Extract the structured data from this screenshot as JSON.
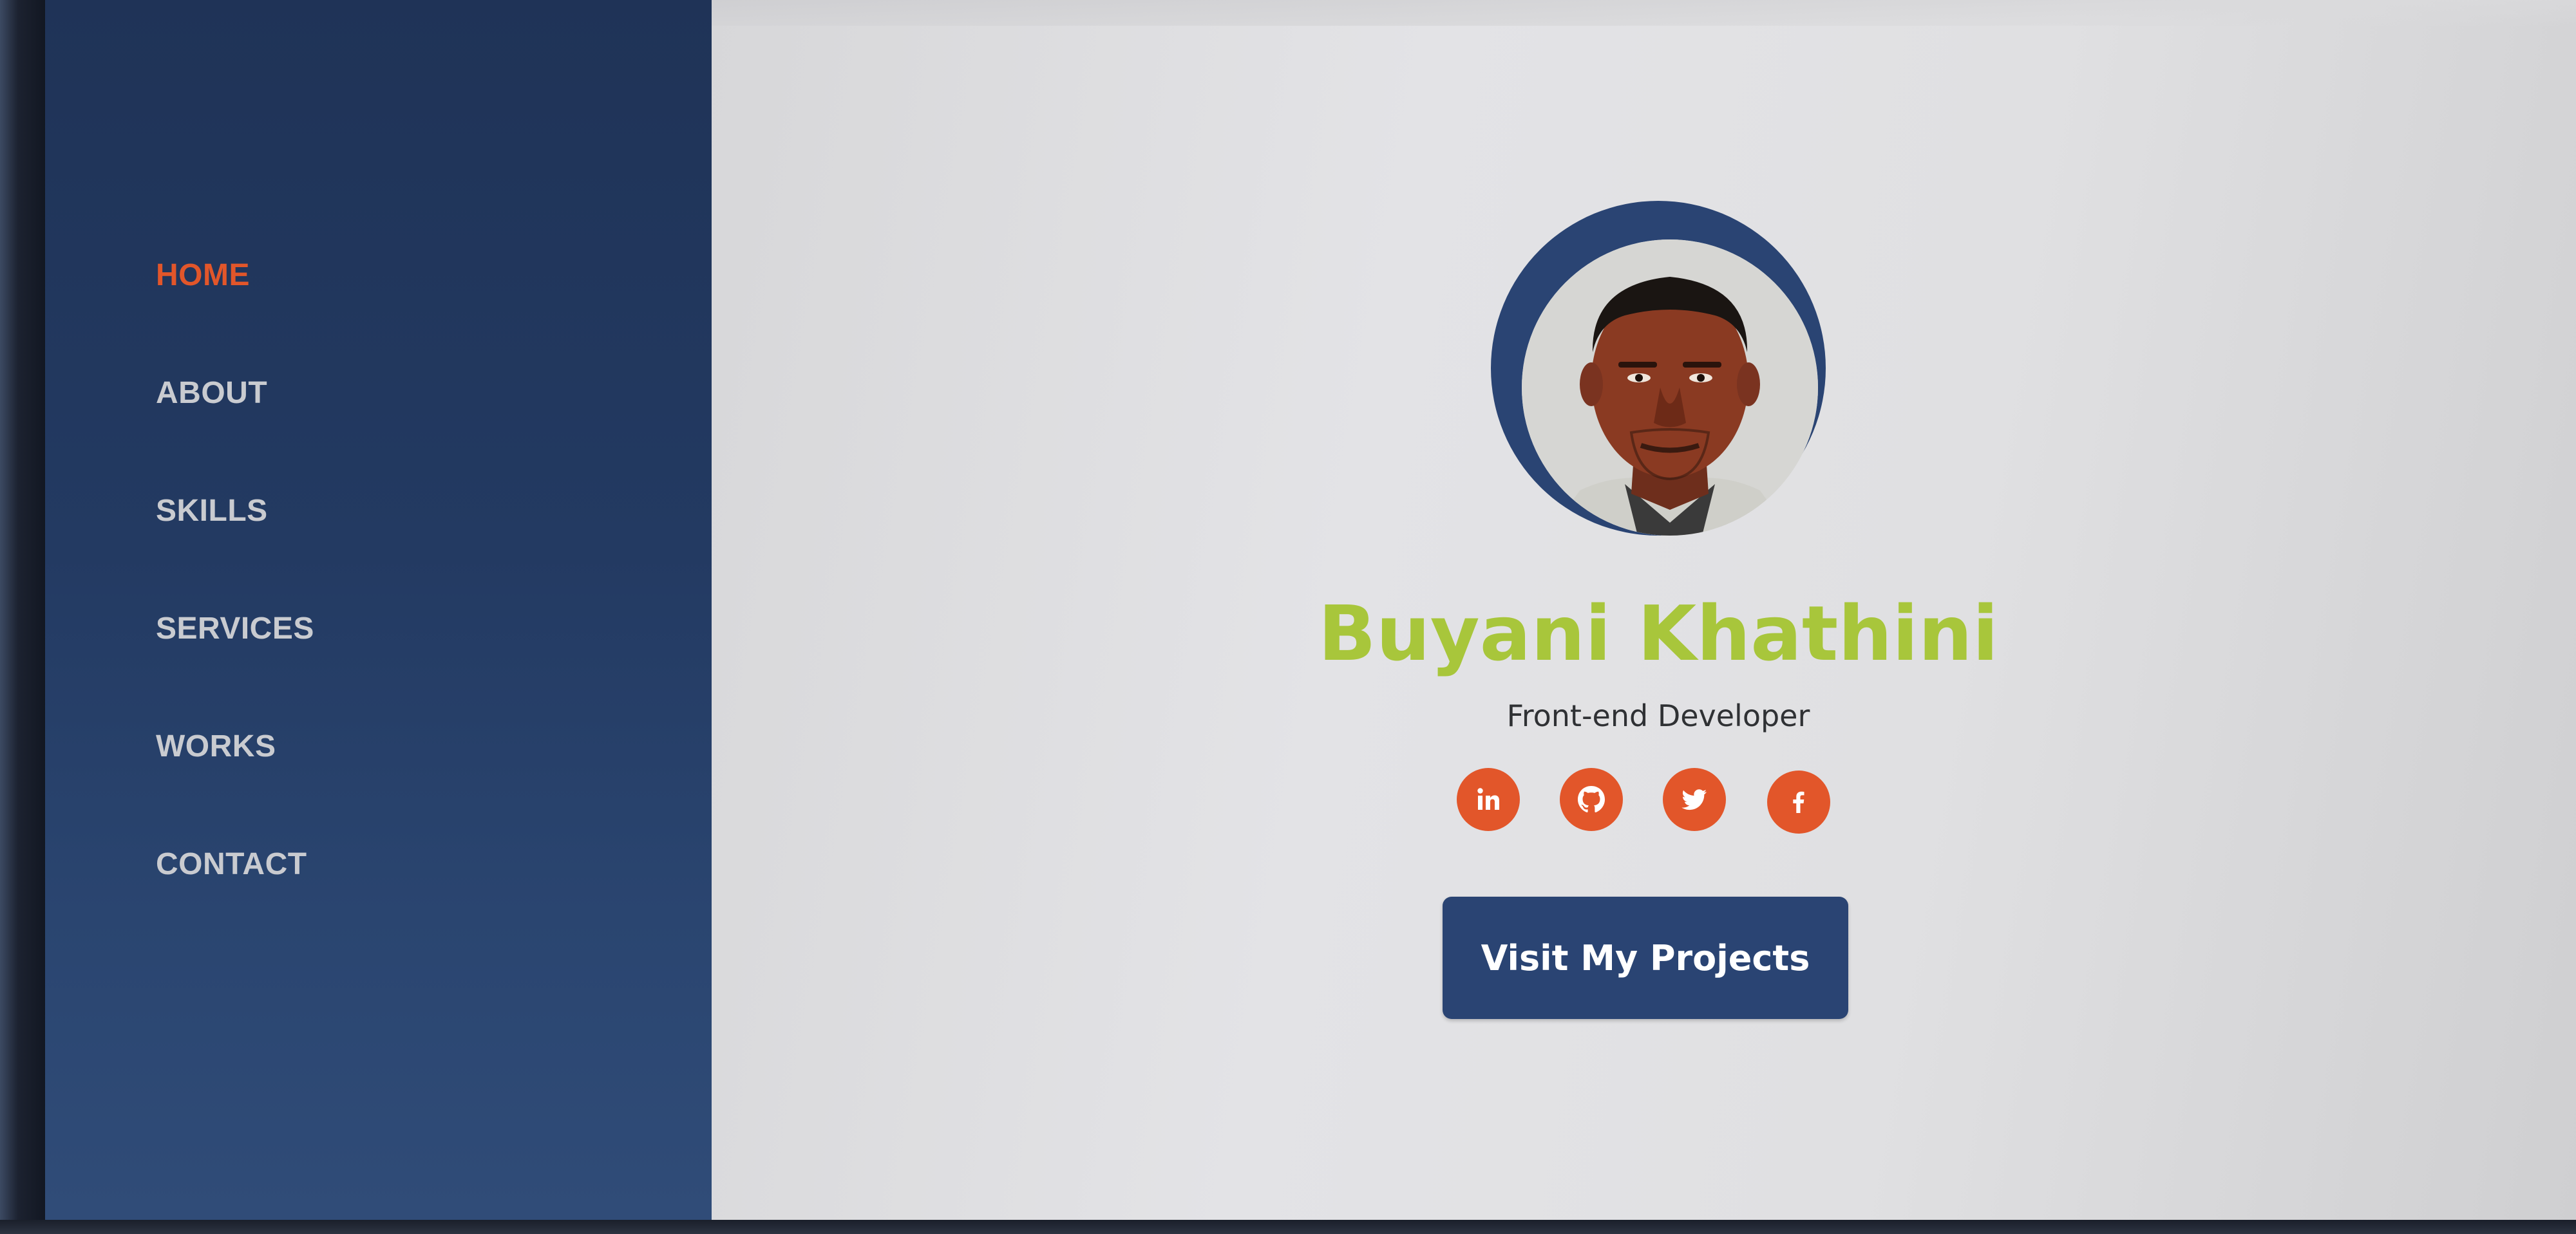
{
  "sidebar": {
    "items": [
      {
        "label": "HOME",
        "active": true
      },
      {
        "label": "ABOUT",
        "active": false
      },
      {
        "label": "SKILLS",
        "active": false
      },
      {
        "label": "SERVICES",
        "active": false
      },
      {
        "label": "WORKS",
        "active": false
      },
      {
        "label": "CONTACT",
        "active": false
      }
    ]
  },
  "hero": {
    "name": "Buyani Khathini",
    "role": "Front-end Developer",
    "cta_label": "Visit My Projects",
    "social_icons": [
      "linkedin-icon",
      "github-icon",
      "twitter-icon",
      "facebook-icon"
    ]
  },
  "colors": {
    "sidebar_bg": "#233a62",
    "accent_orange": "#e2562a",
    "name_green": "#a8c63b",
    "button_bg": "#2a4473",
    "main_bg": "#e0e0e2"
  }
}
